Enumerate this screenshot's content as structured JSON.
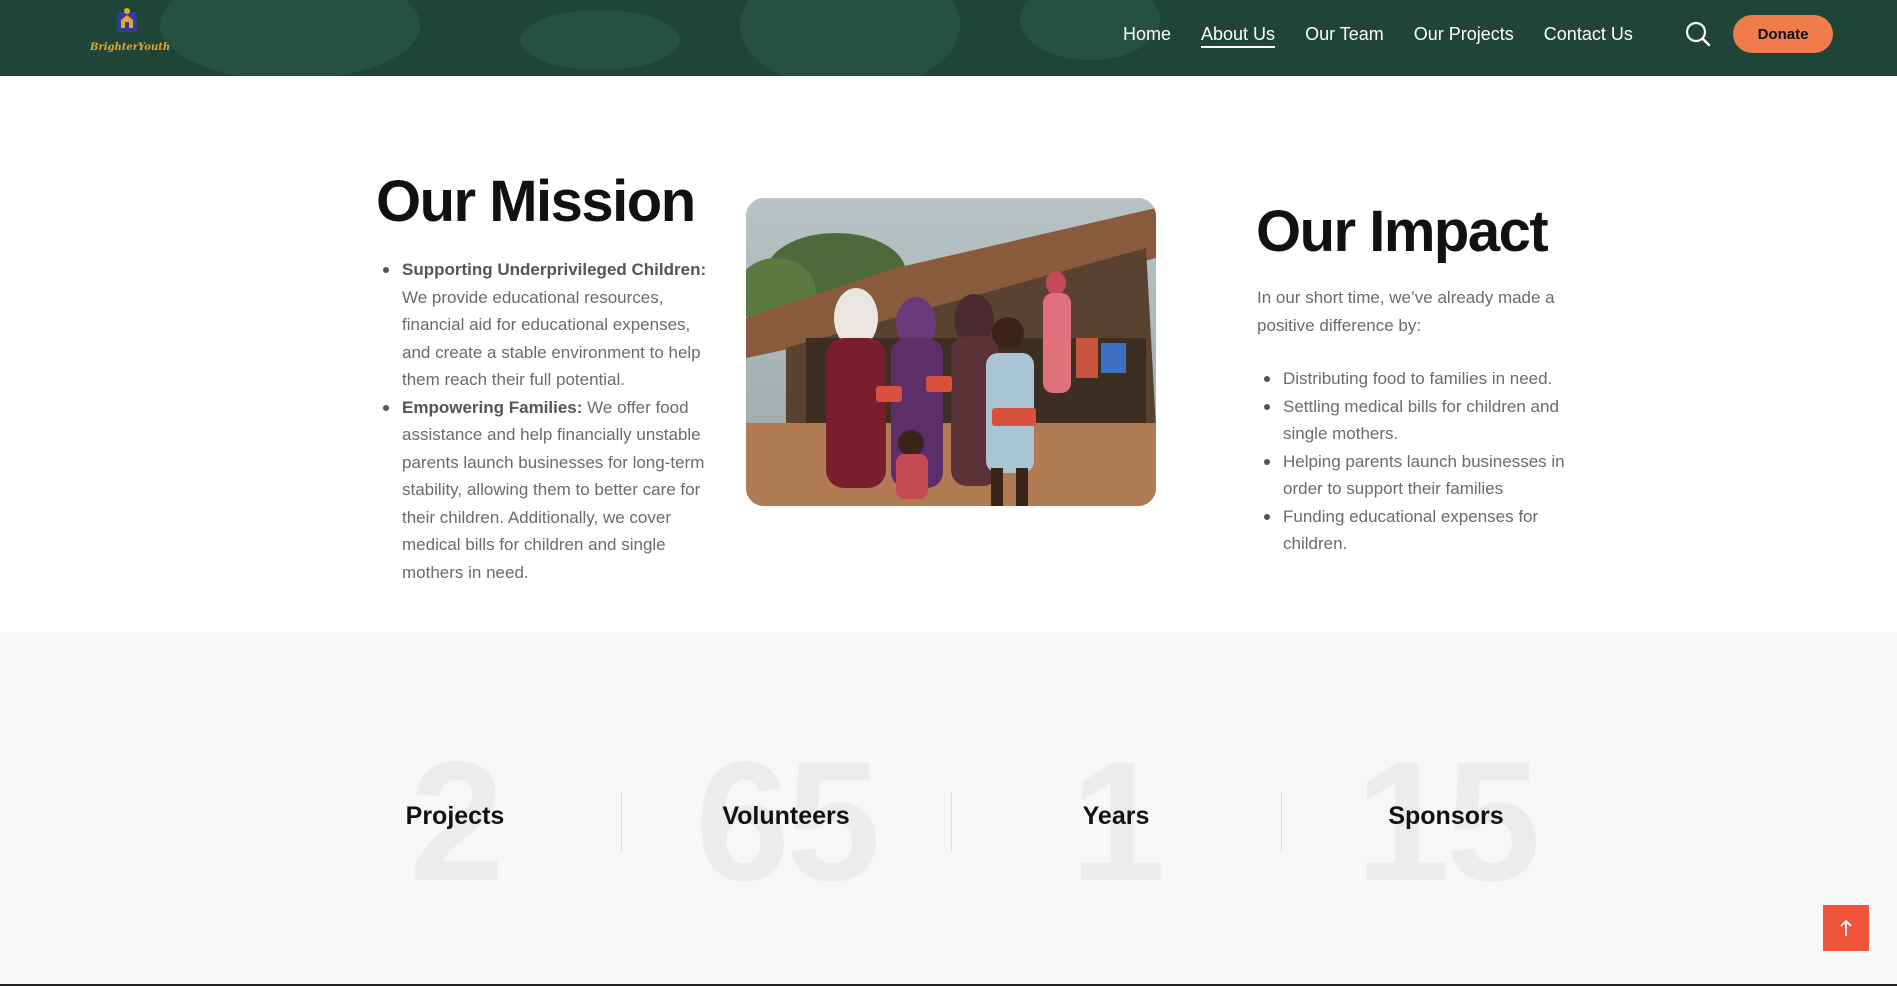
{
  "header": {
    "logo_text": "BrighterYouth",
    "nav": [
      {
        "label": "Home"
      },
      {
        "label": "About Us"
      },
      {
        "label": "Our Team"
      },
      {
        "label": "Our Projects"
      },
      {
        "label": "Contact Us"
      }
    ],
    "active_nav": "About Us",
    "donate_label": "Donate",
    "icons": {
      "search": "search-icon"
    },
    "colors": {
      "header_bg": "#1f4538",
      "donate_bg": "#f07c4b",
      "accent": "#f0553a"
    }
  },
  "mission": {
    "title": "Our Mission",
    "items": [
      {
        "heading": "Supporting Underprivileged Children:",
        "text": " We provide educational resources, financial aid for educational expenses, and create a stable environment to help them reach their full potential."
      },
      {
        "heading": "Empowering Families:",
        "text": " We offer food assistance and help financially unstable parents launch businesses for long-term stability, allowing them to better care for their children. Additionally, we cover medical bills for children and single mothers in need."
      }
    ]
  },
  "impact": {
    "title": "Our Impact",
    "intro": "In our short time, we’ve already made a positive difference by:",
    "items": [
      "Distributing food to families in need.",
      "Settling medical bills for children and single mothers.",
      "Helping parents launch businesses in order to support their families",
      "Funding educational expenses for children."
    ]
  },
  "stats": [
    {
      "number": "2",
      "label": "Projects"
    },
    {
      "number": "65",
      "label": "Volunteers"
    },
    {
      "number": "1",
      "label": "Years"
    },
    {
      "number": "15",
      "label": "Sponsors"
    }
  ],
  "back_to_top_icon": "arrow-up-icon"
}
